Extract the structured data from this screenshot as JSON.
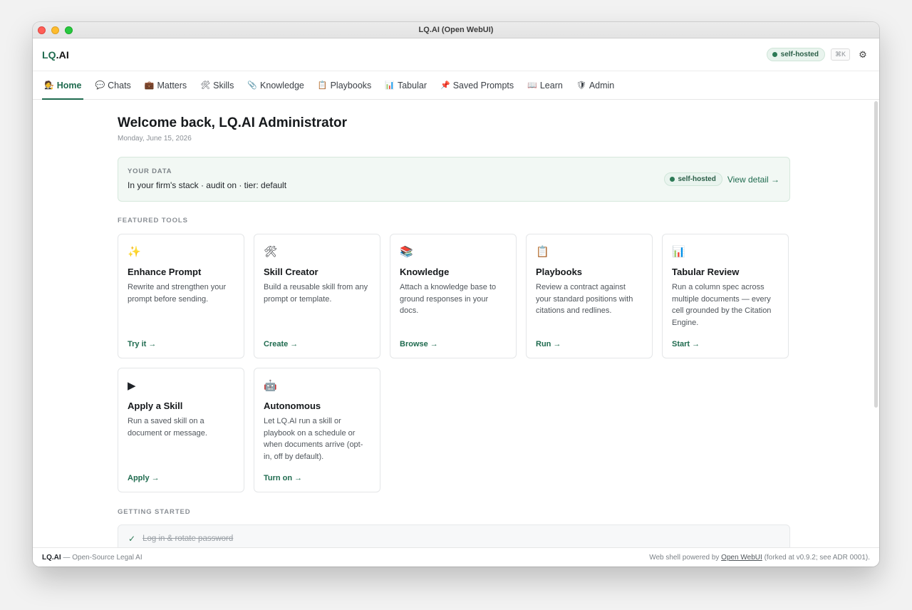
{
  "window": {
    "title": "LQ.AI (Open WebUI)"
  },
  "header": {
    "logo_prefix": "LQ",
    "logo_suffix": ".AI",
    "badge": "self-hosted",
    "shortcut": "⌘K",
    "settings_icon": "gear-icon"
  },
  "nav": [
    {
      "icon": "🧑‍⚖️",
      "label": "Home",
      "active": true
    },
    {
      "icon": "💬",
      "label": "Chats"
    },
    {
      "icon": "💼",
      "label": "Matters"
    },
    {
      "icon": "🛠",
      "label": "Skills"
    },
    {
      "icon": "📎",
      "label": "Knowledge"
    },
    {
      "icon": "📋",
      "label": "Playbooks"
    },
    {
      "icon": "📊",
      "label": "Tabular"
    },
    {
      "icon": "📌",
      "label": "Saved Prompts"
    },
    {
      "icon": "📖",
      "label": "Learn"
    },
    {
      "icon": "🛡",
      "label": "Admin"
    }
  ],
  "main": {
    "welcome": "Welcome back, LQ.AI Administrator",
    "date": "Monday, June 15, 2026",
    "your_data": {
      "caption": "YOUR DATA",
      "line": "In your firm's stack · audit on · tier: default",
      "badge": "self-hosted",
      "link": "View detail →"
    },
    "featured_caption": "FEATURED TOOLS",
    "tools": [
      {
        "icon": "✨",
        "title": "Enhance Prompt",
        "desc": "Rewrite and strengthen your prompt before sending.",
        "action": "Try it →"
      },
      {
        "icon": "🛠",
        "title": "Skill Creator",
        "desc": "Build a reusable skill from any prompt or template.",
        "action": "Create →"
      },
      {
        "icon": "📚",
        "title": "Knowledge",
        "desc": "Attach a knowledge base to ground responses in your docs.",
        "action": "Browse →"
      },
      {
        "icon": "📋",
        "title": "Playbooks",
        "desc": "Review a contract against your standard positions with citations and redlines.",
        "action": "Run →"
      },
      {
        "icon": "📊",
        "title": "Tabular Review",
        "desc": "Run a column spec across multiple documents — every cell grounded by the Citation Engine.",
        "action": "Start →"
      },
      {
        "icon": "▶",
        "title": "Apply a Skill",
        "desc": "Run a saved skill on a document or message.",
        "action": "Apply →"
      },
      {
        "icon": "🤖",
        "title": "Autonomous",
        "desc": "Let LQ.AI run a skill or playbook on a schedule or when documents arrive (opt-in, off by default).",
        "action": "Turn on →"
      }
    ],
    "getting_started_caption": "GETTING STARTED",
    "checklist": [
      {
        "label": "Log in & rotate password",
        "done": true
      }
    ]
  },
  "footer": {
    "brand": "LQ.AI",
    "tagline": " — Open-Source Legal AI",
    "right_prefix": "Web shell powered by ",
    "right_link": "Open WebUI",
    "right_suffix": " (forked at v0.9.2; see ADR 0001)."
  },
  "colors": {
    "accent": "#1f6b4f",
    "badge_bg": "#e9f4ee"
  }
}
